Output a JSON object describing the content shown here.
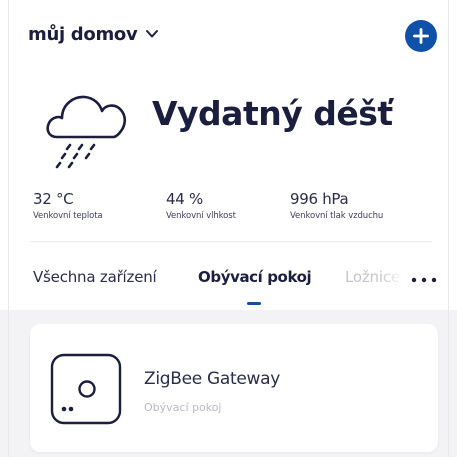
{
  "header": {
    "home_name": "můj domov",
    "dropdown_icon": "chevron-down-icon",
    "add_icon": "plus-icon",
    "accent_color": "#0f50a8"
  },
  "weather": {
    "icon": "cloud-rain-icon",
    "condition": "Vydatný déšť",
    "stats": [
      {
        "value": "32 °C",
        "label": "Venkovní teplota"
      },
      {
        "value": "44 %",
        "label": "Venkovní vlhkost"
      },
      {
        "value": "996 hPa",
        "label": "Venkovní tlak vzduchu"
      }
    ]
  },
  "tabs": {
    "items": [
      {
        "label": "Všechna zařízení",
        "active": false
      },
      {
        "label": "Obývací pokoj",
        "active": true
      },
      {
        "label": "Ložnice",
        "active": false
      }
    ],
    "more_icon": "more-horizontal-icon"
  },
  "devices": [
    {
      "name": "ZigBee Gateway",
      "room": "Obývací pokoj",
      "icon": "gateway-icon"
    }
  ]
}
